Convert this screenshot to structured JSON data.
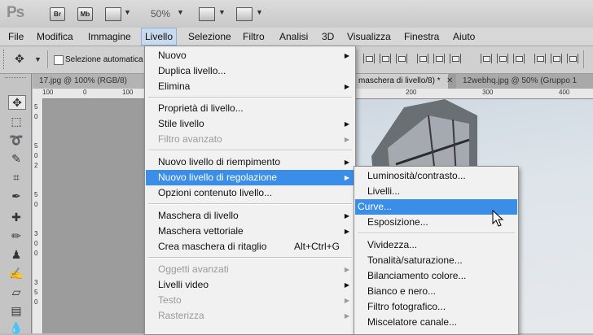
{
  "appbar": {
    "logo": "Ps",
    "br_label": "Br",
    "mb_label": "Mb",
    "zoom": "50%"
  },
  "menubar": [
    "File",
    "Modifica",
    "Immagine",
    "Livello",
    "Selezione",
    "Filtro",
    "Analisi",
    "3D",
    "Visualizza",
    "Finestra",
    "Aiuto"
  ],
  "options": {
    "autoselect_label": "Selezione automatica"
  },
  "tabs": [
    "17.jpg @ 100% (RGB/8)",
    "maschera di livello/8) *",
    "12webhq.jpg @ 50% (Gruppo 1"
  ],
  "ruler": {
    "h_labels": [
      "100",
      "0",
      "100",
      "200",
      "300",
      "400"
    ],
    "v_labels": [
      "5",
      "0",
      "5",
      "0",
      "2",
      "5",
      "0",
      "3",
      "0",
      "0",
      "3",
      "5",
      "0"
    ]
  },
  "livello_menu": {
    "items": [
      {
        "label": "Nuovo",
        "submenu": true
      },
      {
        "label": "Duplica livello..."
      },
      {
        "label": "Elimina",
        "submenu": true
      },
      {
        "label": "Proprietà di livello..."
      },
      {
        "label": "Stile livello",
        "submenu": true
      },
      {
        "label": "Filtro avanzato",
        "submenu": true,
        "disabled": true
      },
      {
        "label": "Nuovo livello di riempimento",
        "submenu": true
      },
      {
        "label": "Nuovo livello di regolazione",
        "submenu": true,
        "highlighted": true
      },
      {
        "label": "Opzioni contenuto livello..."
      },
      {
        "label": "Maschera di livello",
        "submenu": true
      },
      {
        "label": "Maschera vettoriale",
        "submenu": true
      },
      {
        "label": "Crea maschera di ritaglio",
        "shortcut": "Alt+Ctrl+G"
      },
      {
        "label": "Oggetti avanzati",
        "submenu": true,
        "disabled": true
      },
      {
        "label": "Livelli video",
        "submenu": true
      },
      {
        "label": "Testo",
        "submenu": true,
        "disabled": true
      },
      {
        "label": "Rasterizza",
        "submenu": true,
        "disabled": true
      }
    ]
  },
  "regolazione_submenu": {
    "items": [
      {
        "label": "Luminosità/contrasto..."
      },
      {
        "label": "Livelli..."
      },
      {
        "label": "Curve...",
        "highlighted": true
      },
      {
        "label": "Esposizione..."
      },
      {
        "label": "Vividezza..."
      },
      {
        "label": "Tonalità/saturazione..."
      },
      {
        "label": "Bilanciamento colore..."
      },
      {
        "label": "Bianco e nero..."
      },
      {
        "label": "Filtro fotografico..."
      },
      {
        "label": "Miscelatore canale..."
      }
    ]
  },
  "colors": {
    "highlight": "#3b8ee8",
    "menu_bg": "#f1f1f1",
    "disabled_text": "#9a9a9a"
  }
}
